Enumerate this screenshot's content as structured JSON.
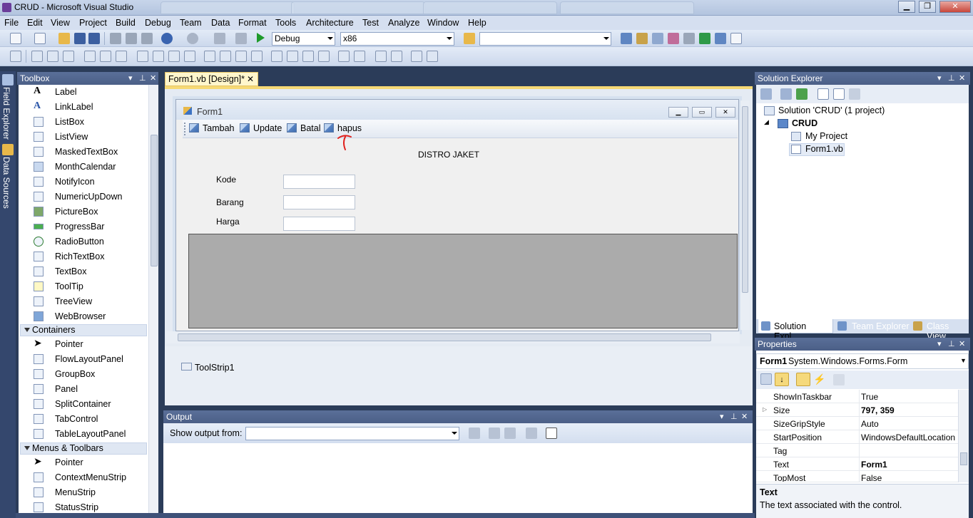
{
  "window": {
    "title": "CRUD - Microsoft Visual Studio",
    "min": "▁",
    "restore": "❐",
    "close": "✕"
  },
  "menu": [
    "File",
    "Edit",
    "View",
    "Project",
    "Build",
    "Debug",
    "Team",
    "Data",
    "Format",
    "Tools",
    "Architecture",
    "Test",
    "Analyze",
    "Window",
    "Help"
  ],
  "toolbar": {
    "config": "Debug",
    "platform": "x86",
    "find": ""
  },
  "toolbox": {
    "title": "Toolbox",
    "items_a": [
      "Label",
      "LinkLabel",
      "ListBox",
      "ListView",
      "MaskedTextBox",
      "MonthCalendar",
      "NotifyIcon",
      "NumericUpDown",
      "PictureBox",
      "ProgressBar",
      "RadioButton",
      "RichTextBox",
      "TextBox",
      "ToolTip",
      "TreeView",
      "WebBrowser"
    ],
    "cat_containers": "Containers",
    "items_b": [
      "Pointer",
      "FlowLayoutPanel",
      "GroupBox",
      "Panel",
      "SplitContainer",
      "TabControl",
      "TableLayoutPanel"
    ],
    "cat_menus": "Menus & Toolbars",
    "items_c": [
      "Pointer",
      "ContextMenuStrip",
      "MenuStrip",
      "StatusStrip"
    ]
  },
  "side_tabs": {
    "field_explorer": "Field Explorer",
    "data_sources": "Data Sources"
  },
  "designer": {
    "tab": "Form1.vb [Design]*",
    "form_title": "Form1",
    "toolstrip": [
      "Tambah",
      "Update",
      "Batal",
      "hapus"
    ],
    "heading": "DISTRO JAKET",
    "labels": [
      "Kode",
      "Barang",
      "Harga"
    ],
    "tray_item": "ToolStrip1"
  },
  "output": {
    "title": "Output",
    "show_from": "Show output from:"
  },
  "solution": {
    "title": "Solution Explorer",
    "root": "Solution 'CRUD' (1 project)",
    "project": "CRUD",
    "items": [
      "My Project",
      "Form1.vb"
    ],
    "tabs": [
      "Solution Expl...",
      "Team Explorer",
      "Class View"
    ]
  },
  "properties": {
    "title": "Properties",
    "object": "Form1",
    "type": "System.Windows.Forms.Form",
    "rows": [
      {
        "name": "ShowInTaskbar",
        "value": "True"
      },
      {
        "name": "Size",
        "value": "797, 359"
      },
      {
        "name": "SizeGripStyle",
        "value": "Auto"
      },
      {
        "name": "StartPosition",
        "value": "WindowsDefaultLocation"
      },
      {
        "name": "Tag",
        "value": ""
      },
      {
        "name": "Text",
        "value": "Form1"
      },
      {
        "name": "TopMost",
        "value": "False"
      }
    ],
    "desc_title": "Text",
    "desc": "The text associated with the control."
  },
  "colors": {
    "accent_tab": "#fff6cc",
    "panel_head": "#4b5f87",
    "annotation": "#e0201c"
  }
}
